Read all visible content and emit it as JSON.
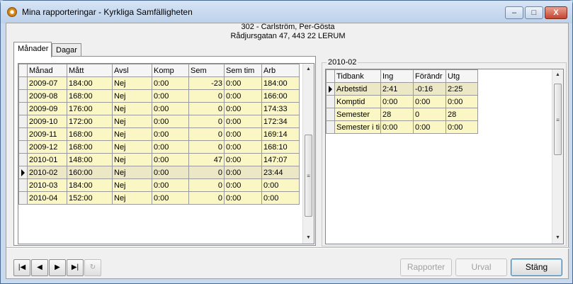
{
  "window": {
    "title": "Mina rapporteringar - Kyrkliga Samfälligheten",
    "controls": {
      "minimize": "–",
      "maximize": "□",
      "close": "X"
    }
  },
  "header": {
    "line1": "302 - Carlström, Per-Gösta",
    "line2": "Rådjursgatan 47, 443 22  LERUM"
  },
  "tabs": [
    {
      "label": "Månader",
      "active": true
    },
    {
      "label": "Dagar",
      "active": false
    }
  ],
  "months_grid": {
    "columns": [
      "Månad",
      "Mått",
      "Avsl",
      "Komp",
      "Sem",
      "Sem tim",
      "Arb"
    ],
    "rows": [
      {
        "cells": [
          "2009-07",
          "184:00",
          "Nej",
          "0:00",
          "-23",
          "0:00",
          "184:00"
        ],
        "current": false
      },
      {
        "cells": [
          "2009-08",
          "168:00",
          "Nej",
          "0:00",
          "0",
          "0:00",
          "166:00"
        ],
        "current": false
      },
      {
        "cells": [
          "2009-09",
          "176:00",
          "Nej",
          "0:00",
          "0",
          "0:00",
          "174:33"
        ],
        "current": false
      },
      {
        "cells": [
          "2009-10",
          "172:00",
          "Nej",
          "0:00",
          "0",
          "0:00",
          "172:34"
        ],
        "current": false
      },
      {
        "cells": [
          "2009-11",
          "168:00",
          "Nej",
          "0:00",
          "0",
          "0:00",
          "169:14"
        ],
        "current": false
      },
      {
        "cells": [
          "2009-12",
          "168:00",
          "Nej",
          "0:00",
          "0",
          "0:00",
          "168:10"
        ],
        "current": false
      },
      {
        "cells": [
          "2010-01",
          "148:00",
          "Nej",
          "0:00",
          "47",
          "0:00",
          "147:07"
        ],
        "current": false
      },
      {
        "cells": [
          "2010-02",
          "160:00",
          "Nej",
          "0:00",
          "0",
          "0:00",
          "23:44"
        ],
        "current": true
      },
      {
        "cells": [
          "2010-03",
          "184:00",
          "Nej",
          "0:00",
          "0",
          "0:00",
          "0:00"
        ],
        "current": false
      },
      {
        "cells": [
          "2010-04",
          "152:00",
          "Nej",
          "0:00",
          "0",
          "0:00",
          "0:00"
        ],
        "current": false
      }
    ]
  },
  "detail": {
    "group_label": "2010-02",
    "columns": [
      "Tidbank",
      "Ing",
      "Förändr",
      "Utg"
    ],
    "rows": [
      {
        "cells": [
          "Arbetstid",
          "2:41",
          "-0:16",
          "2:25"
        ],
        "current": true
      },
      {
        "cells": [
          "Komptid",
          "0:00",
          "0:00",
          "0:00"
        ],
        "current": false
      },
      {
        "cells": [
          "Semester",
          "28",
          "0",
          "28"
        ],
        "current": false
      },
      {
        "cells": [
          "Semester i tir",
          "0:00",
          "0:00",
          "0:00"
        ],
        "current": false
      }
    ]
  },
  "navigation": {
    "first": "|◀",
    "prev": "◀",
    "next": "▶",
    "last": "▶|",
    "refresh": "↻"
  },
  "buttons": {
    "report": "Rapporter",
    "select": "Urval",
    "close": "Stäng"
  },
  "scroll_glyphs": {
    "up": "▲",
    "down": "▼",
    "grip": "≡"
  }
}
